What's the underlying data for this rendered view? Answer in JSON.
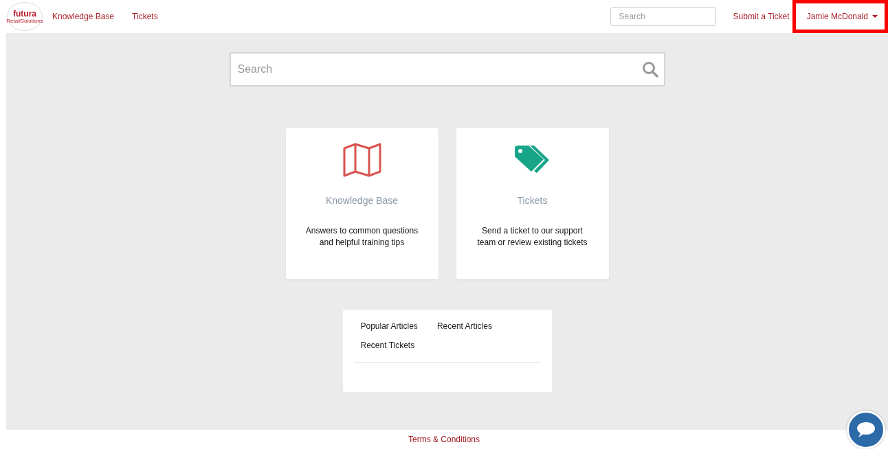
{
  "header": {
    "logo": {
      "wordmark": "futura",
      "tagline": "RetailSolutions"
    },
    "nav": [
      "Knowledge Base",
      "Tickets"
    ],
    "search": {
      "placeholder": "Search"
    },
    "submit_link": "Submit a Ticket",
    "user_menu": {
      "label": "Jamie McDonald",
      "highlighted": true
    }
  },
  "main_search": {
    "placeholder": "Search"
  },
  "cards": [
    {
      "kind": "map",
      "title": "Knowledge Base",
      "description": "Answers to common questions and helpful training tips"
    },
    {
      "kind": "tags",
      "title": "Tickets",
      "description": "Send a ticket to our support team or review existing tickets"
    }
  ],
  "article_tabs": [
    {
      "label": "Popular Articles"
    },
    {
      "label": "Recent Articles"
    },
    {
      "label": "Recent Tickets"
    }
  ],
  "footer": {
    "link": "Terms & Conditions"
  }
}
